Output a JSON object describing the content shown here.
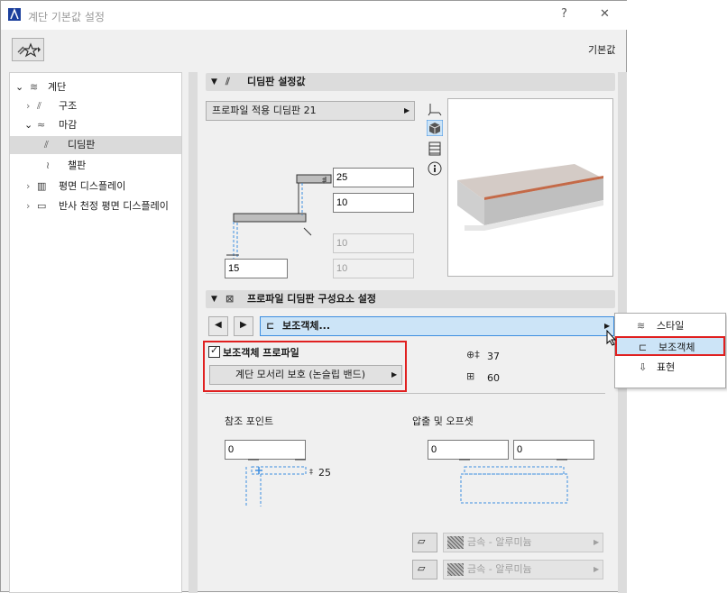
{
  "window": {
    "title": "계단 기본값 설정",
    "help": "?",
    "close": "✕"
  },
  "header": {
    "defaults_label": "기본값"
  },
  "tree": {
    "items": [
      {
        "label": "계단"
      },
      {
        "label": "구조"
      },
      {
        "label": "마감"
      },
      {
        "label": "디딤판"
      },
      {
        "label": "챌판"
      },
      {
        "label": "평면 디스플레이"
      },
      {
        "label": "반사 천정 평면 디스플레이"
      }
    ]
  },
  "tread_settings": {
    "title": "디딤판 설정값",
    "profile_button": "프로파일 적용 디딤판 21",
    "thickness": "25",
    "nosing": "10",
    "disabled_a": "10",
    "disabled_b": "10",
    "offset": "15"
  },
  "component_settings": {
    "title": "프로파일 디딤판 구성요소 설정",
    "component_combo": "보조객체...",
    "profile_checkbox_label": "보조객체 프로파일",
    "profile_checked": true,
    "profile_button": "계단 모서리 보호 (논슬립 밴드)",
    "dim_height": "37",
    "dim_depth": "60",
    "ref_point_label": "참조 포인트",
    "ref_point_value": "0",
    "ref_dim": "25",
    "extrude_label": "압출 및 오프셋",
    "extrude_a": "0",
    "extrude_b": "0",
    "material_1": "금속 - 알루미늄",
    "material_2": "금속 - 알루미늄"
  },
  "popup_menu": {
    "items": [
      {
        "label": "스타일",
        "icon": "style-icon",
        "selected": false
      },
      {
        "label": "보조객체",
        "icon": "sub-object-icon",
        "selected": true
      },
      {
        "label": "표현",
        "icon": "pen-icon",
        "selected": false
      }
    ]
  },
  "colors": {
    "accent": "#3d8ee0",
    "selection": "#cce4f7",
    "highlight_border": "#e02020"
  }
}
